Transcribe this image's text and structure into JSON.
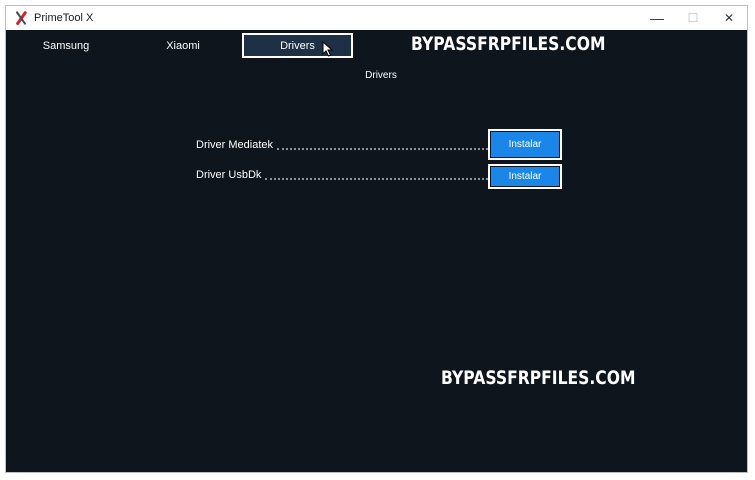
{
  "window": {
    "title": "PrimeTool X",
    "controls": {
      "minimize": "—",
      "maximize": "☐",
      "close": "✕"
    }
  },
  "tabs": [
    {
      "label": "Samsung",
      "selected": false
    },
    {
      "label": "Xiaomi",
      "selected": false
    },
    {
      "label": "Drivers",
      "selected": true
    }
  ],
  "watermark": {
    "top": "BYPASSFRPFILES.COM",
    "bottom": "BYPASSFRPFILES.COM"
  },
  "drivers_section": {
    "heading": "Drivers",
    "items": [
      {
        "label": "Driver Mediatek",
        "button": "Instalar"
      },
      {
        "label": "Driver UsbDk",
        "button": "Instalar"
      }
    ]
  },
  "colors": {
    "background": "#0e151c",
    "selected_tab": "#1e3046",
    "button": "#1a87e8"
  }
}
